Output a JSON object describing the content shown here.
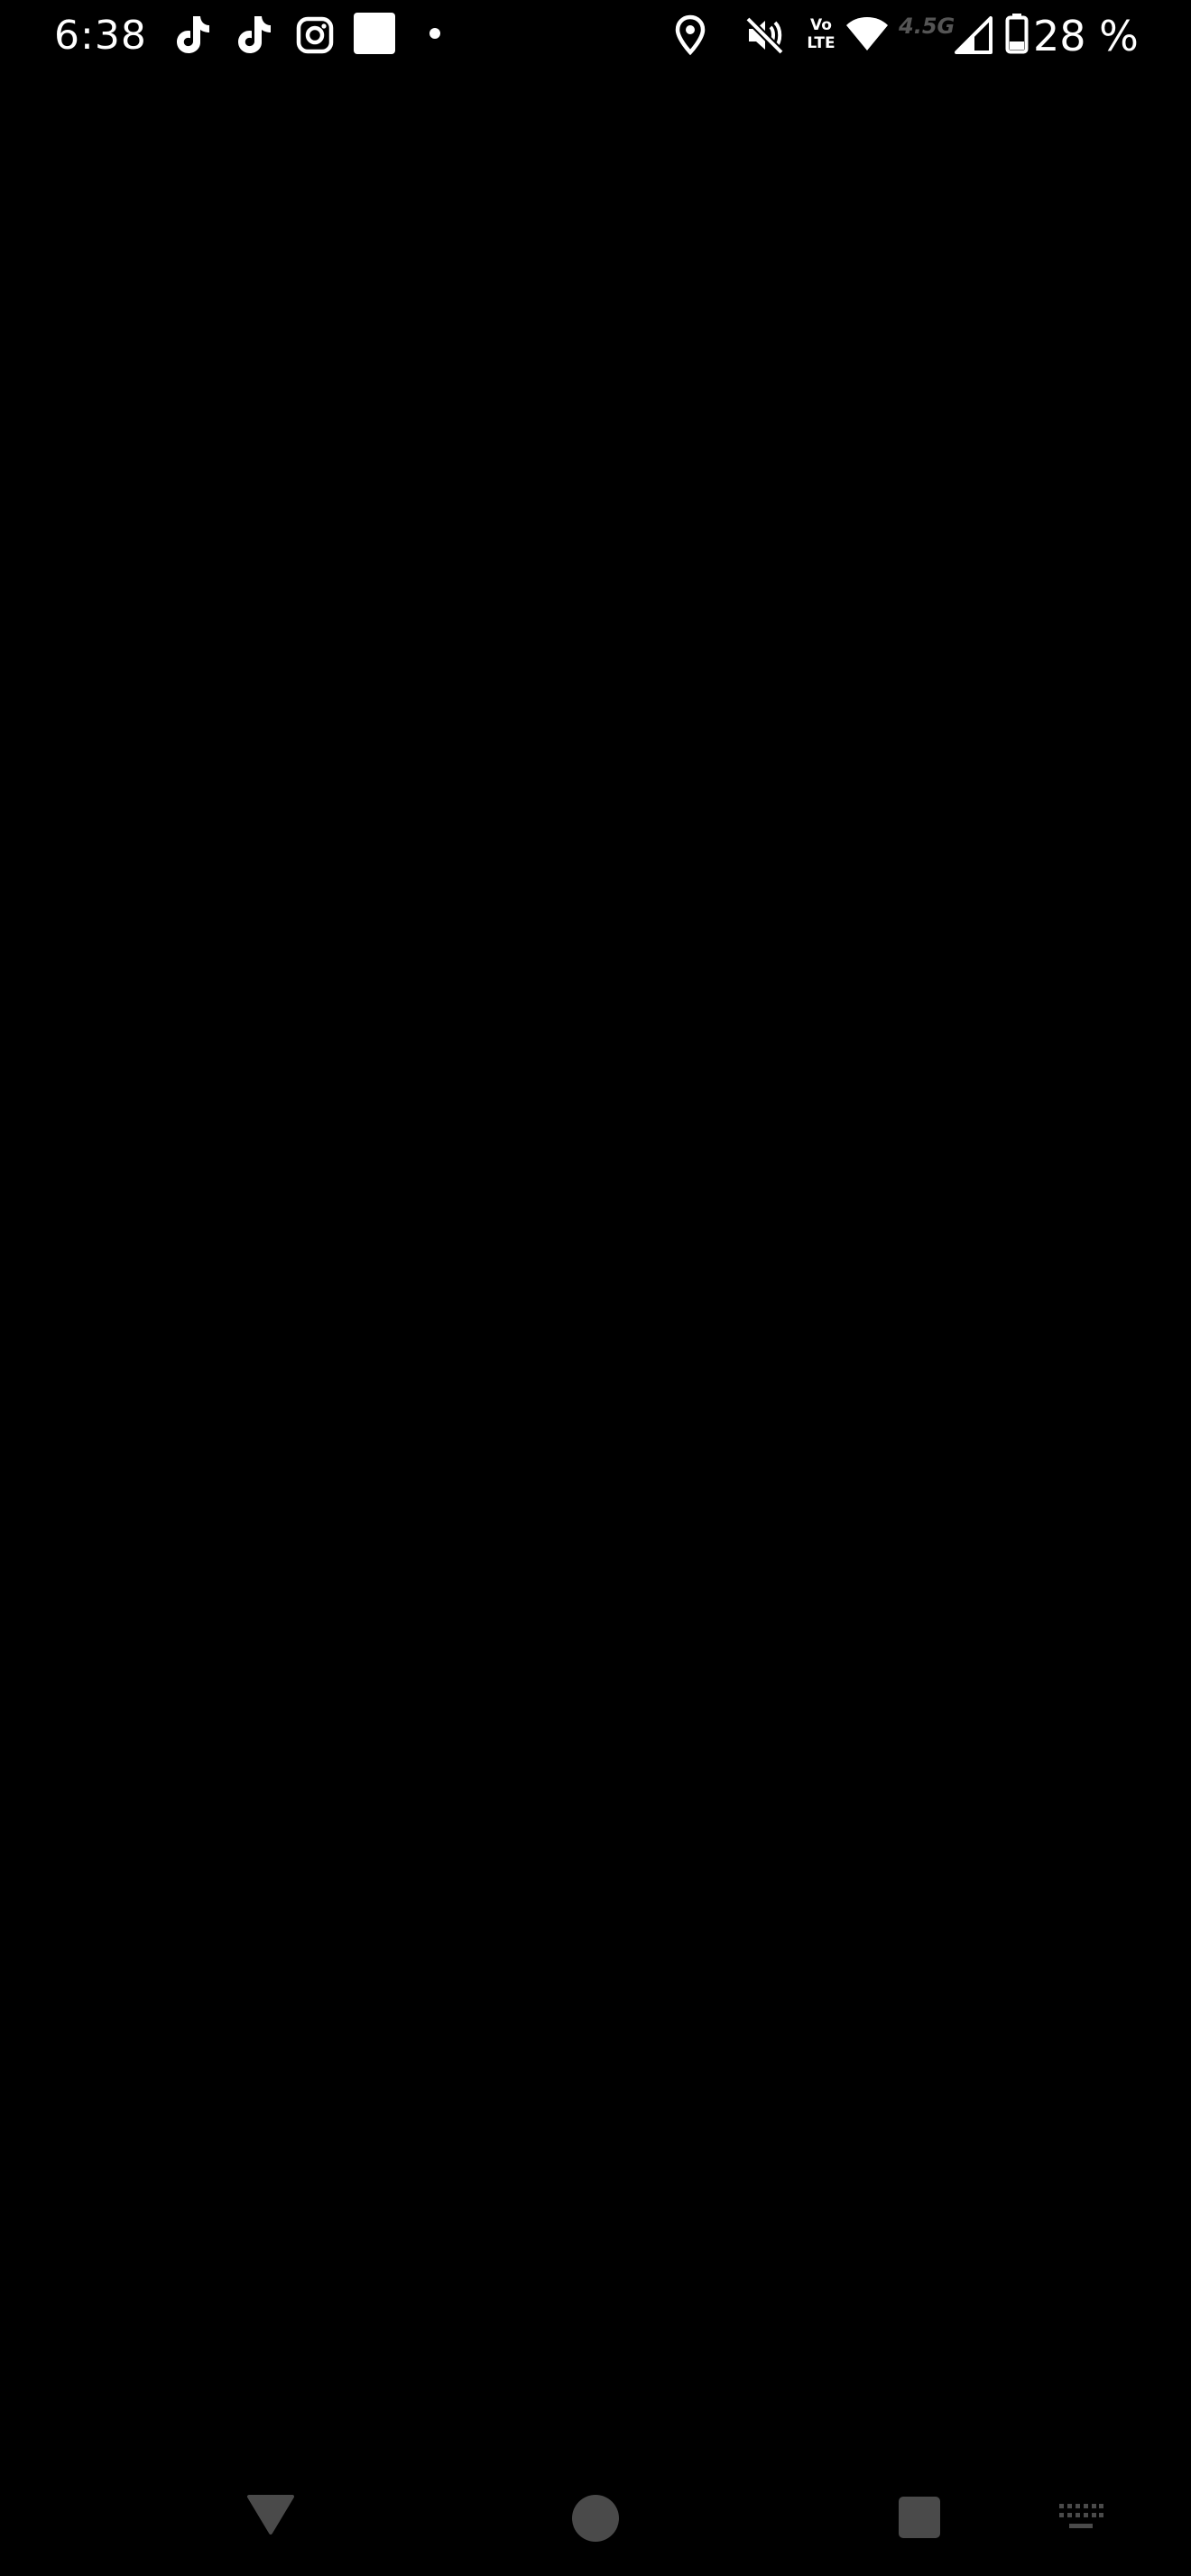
{
  "status_bar": {
    "time": "6:38",
    "notification_icons": [
      "tiktok-icon",
      "tiktok-icon",
      "instagram-icon",
      "app-square-icon",
      "more-dot-icon"
    ],
    "system_icons": [
      "location-icon",
      "vibrate-off-icon",
      "volte-icon",
      "wifi-icon",
      "network-generation",
      "cellular-signal-icon",
      "battery-icon"
    ],
    "volte_line1": "Vo",
    "volte_line2": "LTE",
    "network_generation": "4.5G",
    "battery_percent": "28 %"
  },
  "navigation_bar": {
    "buttons": [
      "back-button",
      "home-button",
      "recents-button",
      "keyboard-switch-button"
    ],
    "color": "#4a4a4a"
  },
  "colors": {
    "background": "#000000",
    "status_text": "#ffffff",
    "dim_text": "#555555"
  }
}
